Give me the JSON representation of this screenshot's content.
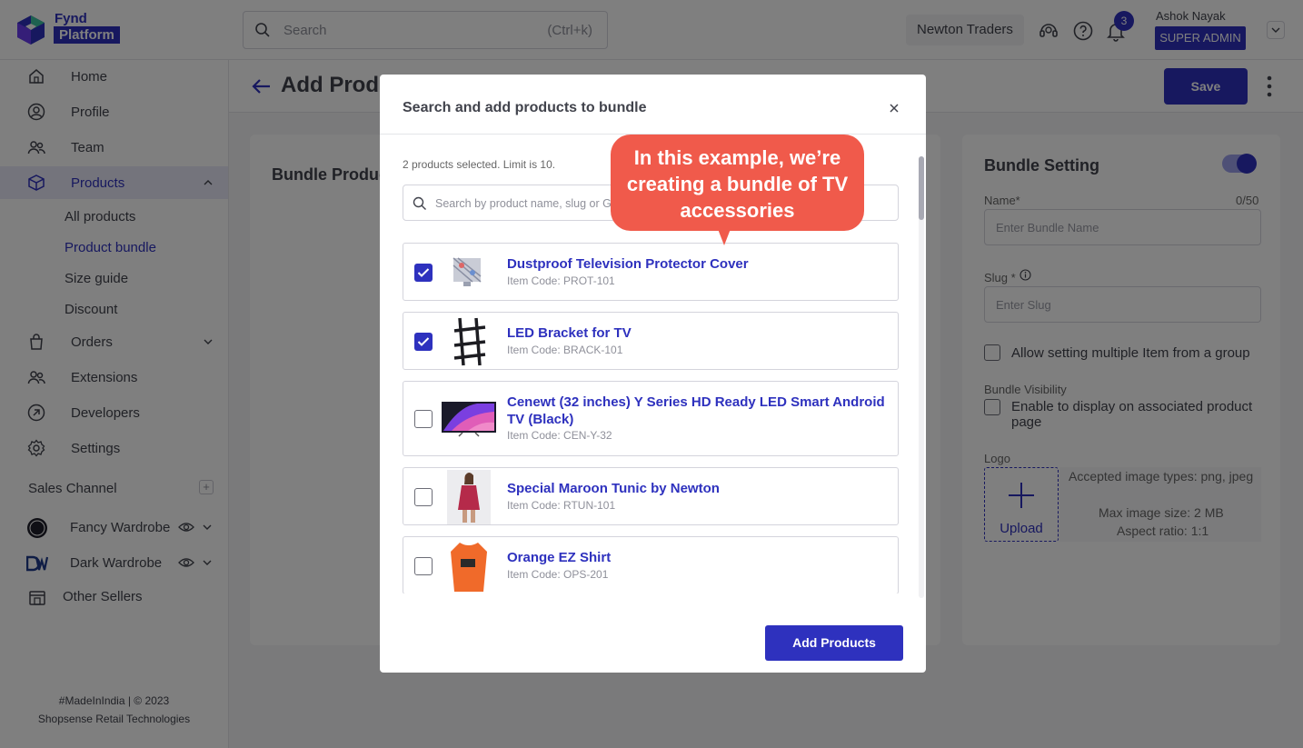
{
  "brand": {
    "line1": "Fynd",
    "line2": "Platform",
    "color": "#2e31be"
  },
  "header": {
    "search_placeholder": "Search",
    "search_shortcut": "(Ctrl+k)",
    "company": "Newton Traders",
    "notifications": "3",
    "user_name": "Ashok Nayak",
    "user_role": "SUPER ADMIN"
  },
  "sidebar": {
    "items": [
      {
        "label": "Home",
        "icon": "home-icon"
      },
      {
        "label": "Profile",
        "icon": "profile-icon"
      },
      {
        "label": "Team",
        "icon": "team-icon"
      },
      {
        "label": "Products",
        "icon": "cube-icon"
      },
      {
        "label": "Orders",
        "icon": "bag-icon"
      },
      {
        "label": "Extensions",
        "icon": "extensions-icon"
      },
      {
        "label": "Developers",
        "icon": "developers-icon"
      },
      {
        "label": "Settings",
        "icon": "gear-icon"
      }
    ],
    "products_sub": [
      "All products",
      "Product bundle",
      "Size guide",
      "Discount"
    ],
    "sales_channel_title": "Sales Channel",
    "channels": [
      {
        "label": "Fancy Wardrobe",
        "badge": "FW"
      },
      {
        "label": "Dark Wardrobe",
        "badge": "DW"
      }
    ],
    "other_sellers": "Other Sellers",
    "footer_line1": "#MadeInIndia | © 2023",
    "footer_line2": "Shopsense Retail Technologies"
  },
  "page": {
    "title": "Add Product bundle",
    "save_label": "Save",
    "left_card_title": "Bundle Products"
  },
  "bundle_setting": {
    "title": "Bundle Setting",
    "name_label": "Name*",
    "name_counter": "0/50",
    "name_placeholder": "Enter Bundle Name",
    "slug_label": "Slug *",
    "slug_placeholder": "Enter Slug",
    "multi_item_label": "Allow setting multiple Item from a group",
    "visibility_title": "Bundle Visibility",
    "visibility_label": "Enable to display on associated product page",
    "logo_label": "Logo",
    "upload_label": "Upload",
    "image_info": [
      "Accepted image types: png, jpeg",
      "Max image size: 2 MB",
      "Aspect ratio: 1:1"
    ]
  },
  "modal": {
    "title": "Search and add products to bundle",
    "selected_text": "2 products selected. Limit is 10.",
    "search_placeholder": "Search by product name, slug or Group ID",
    "add_button": "Add Products",
    "products": [
      {
        "name": "Dustproof Television Protector Cover",
        "code": "Item Code: PROT-101",
        "checked": true
      },
      {
        "name": "LED Bracket for TV",
        "code": "Item Code: BRACK-101",
        "checked": true
      },
      {
        "name": "Cenewt (32 inches) Y Series HD Ready LED Smart Android TV (Black)",
        "code": "Item Code: CEN-Y-32",
        "checked": false
      },
      {
        "name": "Special Maroon Tunic by Newton",
        "code": "Item Code: RTUN-101",
        "checked": false
      },
      {
        "name": "Orange EZ Shirt",
        "code": "Item Code: OPS-201",
        "checked": false
      }
    ]
  },
  "callout": {
    "text": "In this example, we’re creating a bundle of TV accessories",
    "color": "#f05a4b"
  }
}
